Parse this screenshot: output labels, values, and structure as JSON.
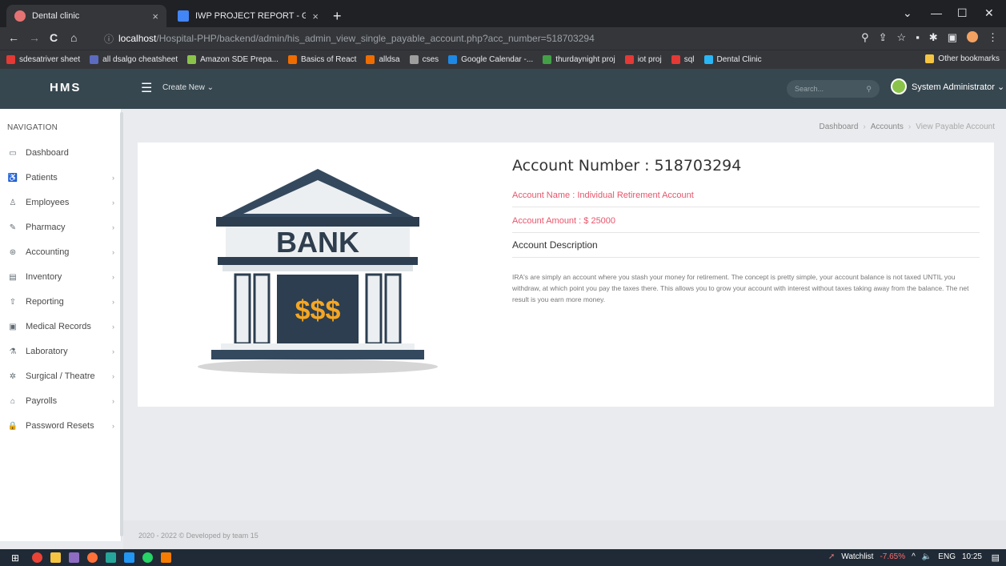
{
  "browser": {
    "tabs": [
      {
        "title": "Dental clinic",
        "active": true,
        "close": "×"
      },
      {
        "title": "IWP PROJECT REPORT - Google [",
        "active": false,
        "close": "×"
      }
    ],
    "new_tab": "+",
    "window_controls": [
      "⌄",
      "—",
      "☐",
      "✕"
    ],
    "nav": [
      "←",
      "→",
      "C",
      "⌂"
    ],
    "url_icon": "ⓘ",
    "url_host": "localhost",
    "url_path": "/Hospital-PHP/backend/admin/his_admin_view_single_payable_account.php?acc_number=518703294",
    "bookmarks": [
      {
        "label": "sdesatriver sheet",
        "color": "#e53935"
      },
      {
        "label": "all dsalgo cheatsheet",
        "color": "#5c6bc0"
      },
      {
        "label": "Amazon SDE Prepa...",
        "color": "#8bc34a"
      },
      {
        "label": "Basics of React",
        "color": "#ef6c00"
      },
      {
        "label": "alldsa",
        "color": "#ef6c00"
      },
      {
        "label": "cses",
        "color": "#9e9e9e"
      },
      {
        "label": "Google Calendar -...",
        "color": "#1e88e5"
      },
      {
        "label": "thurdaynight proj",
        "color": "#43a047"
      },
      {
        "label": "iot proj",
        "color": "#e53935"
      },
      {
        "label": "sql",
        "color": "#e53935"
      },
      {
        "label": "Dental Clinic",
        "color": "#29b6f6"
      }
    ],
    "other_bookmarks": "Other bookmarks"
  },
  "appnav": {
    "logo": "HMS",
    "create_new": "Create New ⌄",
    "search_placeholder": "Search...",
    "search_icon": "⚲",
    "user_name": "System Administrator ⌄"
  },
  "sidebar": {
    "title": "NAVIGATION",
    "items": [
      {
        "label": "Dashboard",
        "icon": "▭",
        "chevron": ""
      },
      {
        "label": "Patients",
        "icon": "♿",
        "chevron": "›"
      },
      {
        "label": "Employees",
        "icon": "♙",
        "chevron": "›"
      },
      {
        "label": "Pharmacy",
        "icon": "✎",
        "chevron": "›"
      },
      {
        "label": "Accounting",
        "icon": "⊛",
        "chevron": "›"
      },
      {
        "label": "Inventory",
        "icon": "▤",
        "chevron": "›"
      },
      {
        "label": "Reporting",
        "icon": "⇧",
        "chevron": "›"
      },
      {
        "label": "Medical Records",
        "icon": "▣",
        "chevron": "›"
      },
      {
        "label": "Laboratory",
        "icon": "⚗",
        "chevron": "›"
      },
      {
        "label": "Surgical / Theatre",
        "icon": "✲",
        "chevron": "›"
      },
      {
        "label": "Payrolls",
        "icon": "⌂",
        "chevron": "›"
      },
      {
        "label": "Password Resets",
        "icon": "🔒",
        "chevron": "›"
      }
    ]
  },
  "breadcrumb": {
    "items": [
      "Dashboard",
      "Accounts",
      "View Payable Account"
    ],
    "sep": "›"
  },
  "account": {
    "title": "Account Number : 518703294",
    "name": "Account Name : Individual Retirement Account",
    "amount": "Account Amount : $ 25000",
    "desc_label": "Account Description",
    "description": "IRA's are simply an account where you stash your money for retirement. The concept is pretty simple, your account balance is not taxed UNTIL you withdraw, at which point you pay the taxes there. This allows you to grow your account with interest without taxes taking away from the balance. The net result is you earn more money."
  },
  "bank_image": {
    "sign": "BANK",
    "money": "$$$"
  },
  "footer": "2020 - 2022 © Developed by team 15",
  "taskbar": {
    "watchlist": "Watchlist",
    "change": "-7.65%",
    "lang": "ENG",
    "time": "10:25"
  }
}
